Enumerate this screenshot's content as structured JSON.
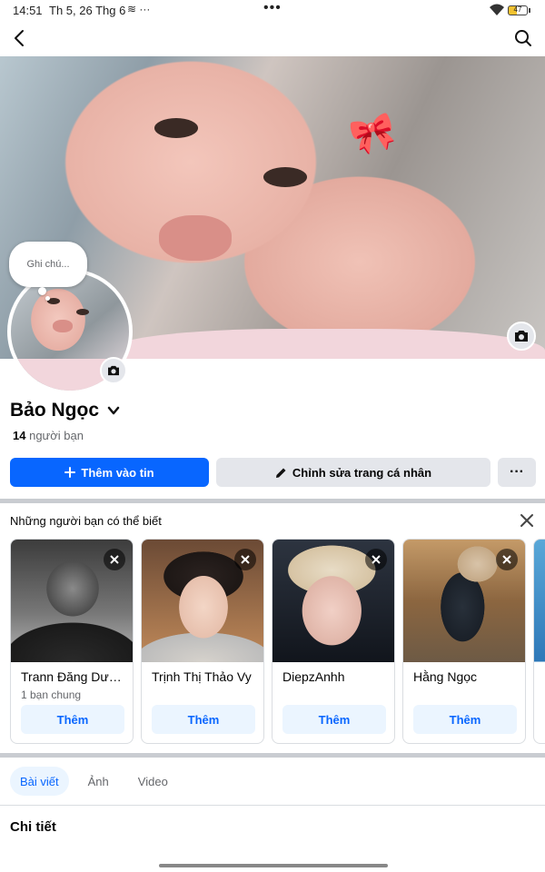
{
  "status_bar": {
    "time": "14:51",
    "date": "Th 5, 26 Thg 6",
    "notif": "≋ ···",
    "center": "•••",
    "battery": "47"
  },
  "profile": {
    "note_placeholder": "Ghi chú...",
    "name": "Bảo Ngọc",
    "friends_count": "14",
    "friends_label": "người bạn"
  },
  "actions": {
    "add_story": "Thêm vào tin",
    "edit_profile": "Chỉnh sửa trang cá nhân",
    "more": "···"
  },
  "pymk": {
    "title": "Những người bạn có thể biết",
    "cards": [
      {
        "name": "Trann Đăng Dương",
        "mutual": "1 bạn chung",
        "add": "Thêm"
      },
      {
        "name": "Trịnh Thị Thảo Vy",
        "mutual": "",
        "add": "Thêm"
      },
      {
        "name": "DiepzAnhh",
        "mutual": "",
        "add": "Thêm"
      },
      {
        "name": "Hằng Ngọc",
        "mutual": "",
        "add": "Thêm"
      }
    ]
  },
  "tabs": [
    "Bài viết",
    "Ảnh",
    "Video"
  ],
  "details_title": "Chi tiết",
  "colors": {
    "primary": "#0866ff",
    "secondary_btn": "#e4e6eb",
    "tab_active_bg": "#ebf5ff"
  },
  "icons": [
    "back-arrow-icon",
    "search-icon",
    "camera-icon",
    "chevron-down-icon",
    "plus-icon",
    "pencil-icon",
    "close-icon"
  ]
}
